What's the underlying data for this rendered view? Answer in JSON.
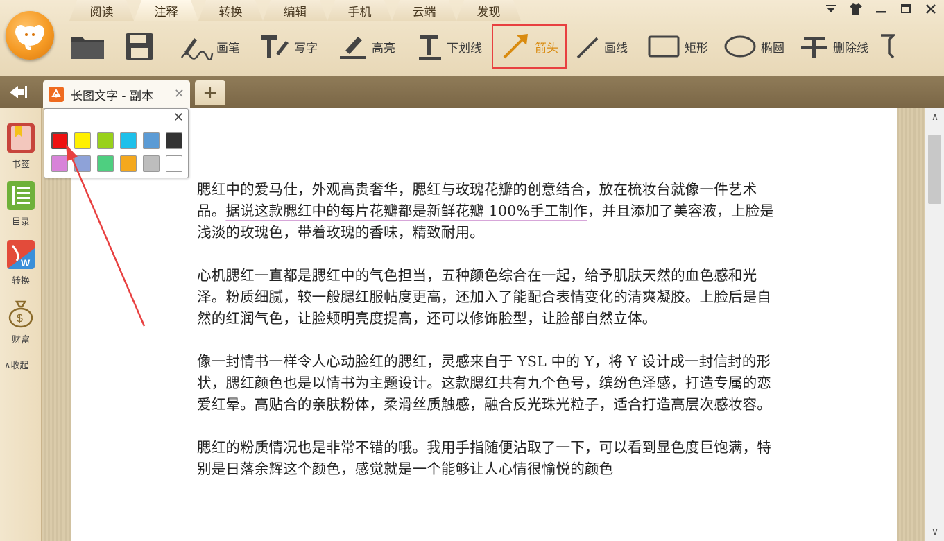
{
  "menu": {
    "tabs": [
      {
        "label": "阅读"
      },
      {
        "label": "注释"
      },
      {
        "label": "转换"
      },
      {
        "label": "编辑"
      },
      {
        "label": "手机"
      },
      {
        "label": "云端"
      },
      {
        "label": "发现"
      }
    ],
    "active_tab": "注释"
  },
  "toolbar": {
    "pen_label": "画笔",
    "write_label": "写字",
    "highlight_label": "高亮",
    "underline_label": "下划线",
    "arrow_label": "箭头",
    "line_label": "画线",
    "rect_label": "矩形",
    "ellipse_label": "椭圆",
    "strikeout_label": "删除线",
    "selected_tool": "箭头"
  },
  "tabbar": {
    "doc_tab_label": "长图文字 - 副本",
    "add_tab_label": "+"
  },
  "sidebar": {
    "bookmark_label": "书签",
    "toc_label": "目录",
    "convert_label": "转换",
    "wealth_label": "财富",
    "collapse_label": "收起"
  },
  "palette": {
    "colors": [
      "#ee1111",
      "#fff000",
      "#99d11b",
      "#1ec0ea",
      "#5b9bd5",
      "#333333",
      "#d883d9",
      "#8ea2d8",
      "#4ecf80",
      "#f4a81d",
      "#bdbdbd",
      "#ffffff"
    ],
    "selected_color": "#ee1111"
  },
  "document": {
    "p1_before": "腮红中的爱马仕，外观高贵奢华，腮红与玫瑰花瓣的创意结合，放在梳妆台就像一件艺术品。",
    "p1_underlined": "据说这款腮红中的每片花瓣都是新鲜花瓣 100%手工制作",
    "p1_after": "，并且添加了美容液，上脸是浅淡的玫瑰色，带着玫瑰的香味，精致耐用。",
    "p2": "心机腮红一直都是腮红中的气色担当，五种颜色综合在一起，给予肌肤天然的血色感和光泽。粉质细腻，较一般腮红服帖度更高，还加入了能配合表情变化的清爽凝胶。上脸后是自然的红润气色，让脸颊明亮度提高，还可以修饰脸型，让脸部自然立体。",
    "p3": "像一封情书一样令人心动脸红的腮红，灵感来自于 YSL 中的 Y，将 Y 设计成一封信封的形状，腮红颜色也是以情书为主题设计。这款腮红共有九个色号，缤纷色泽感，打造专属的恋爱红晕。高贴合的亲肤粉体，柔滑丝质触感，融合反光珠光粒子，适合打造高层次感妆容。",
    "p4": "腮红的粉质情况也是非常不错的哦。我用手指随便沾取了一下，可以看到显色度巨饱满，特别是日落余辉这个颜色，感觉就是一个能够让人心情很愉悦的颜色"
  },
  "annotation": {
    "arrow_color": "#e84040"
  }
}
